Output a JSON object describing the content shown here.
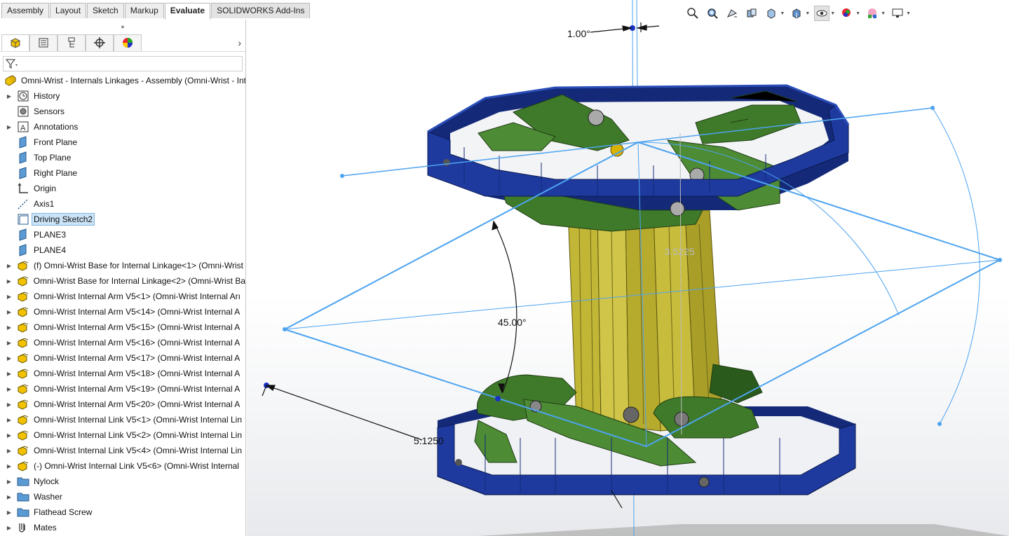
{
  "tabs": [
    {
      "label": "Assembly",
      "active": false
    },
    {
      "label": "Layout",
      "active": false
    },
    {
      "label": "Sketch",
      "active": false
    },
    {
      "label": "Markup",
      "active": false
    },
    {
      "label": "Evaluate",
      "active": true
    },
    {
      "label": "SOLIDWORKS Add-Ins",
      "active": false
    }
  ],
  "panel": {
    "tabs": [
      "feature-manager-icon",
      "property-manager-icon",
      "configuration-manager-icon",
      "dim-xpert-icon",
      "display-manager-icon"
    ],
    "more": "›",
    "filter_icon": "filter-icon",
    "root_label": "Omni-Wrist - Internals Linkages - Assembly (Omni-Wrist - Int",
    "tree": [
      {
        "label": "History",
        "icon": "history-icon",
        "expandable": true
      },
      {
        "label": "Sensors",
        "icon": "sensors-icon",
        "expandable": false
      },
      {
        "label": "Annotations",
        "icon": "annotations-icon",
        "expandable": true
      },
      {
        "label": "Front Plane",
        "icon": "plane-icon",
        "expandable": false
      },
      {
        "label": "Top Plane",
        "icon": "plane-icon",
        "expandable": false
      },
      {
        "label": "Right Plane",
        "icon": "plane-icon",
        "expandable": false
      },
      {
        "label": "Origin",
        "icon": "origin-icon",
        "expandable": false
      },
      {
        "label": "Axis1",
        "icon": "axis-icon",
        "expandable": false
      },
      {
        "label": "Driving Sketch2",
        "icon": "sketch-icon",
        "expandable": false,
        "selected": true
      },
      {
        "label": "PLANE3",
        "icon": "plane-icon",
        "expandable": false
      },
      {
        "label": "PLANE4",
        "icon": "plane-icon",
        "expandable": false
      },
      {
        "label": "(f) Omni-Wrist Base for Internal Linkage<1> (Omni-Wrist",
        "icon": "part-icon",
        "expandable": true
      },
      {
        "label": "Omni-Wrist Base for Internal Linkage<2> (Omni-Wrist Ba",
        "icon": "part-icon",
        "expandable": true
      },
      {
        "label": "Omni-Wrist Internal Arm V5<1> (Omni-Wrist Internal Arı",
        "icon": "part-icon",
        "expandable": true
      },
      {
        "label": "Omni-Wrist Internal Arm V5<14> (Omni-Wrist Internal A",
        "icon": "part-icon",
        "expandable": true
      },
      {
        "label": "Omni-Wrist Internal Arm V5<15> (Omni-Wrist Internal A",
        "icon": "part-icon",
        "expandable": true
      },
      {
        "label": "Omni-Wrist Internal Arm V5<16> (Omni-Wrist Internal A",
        "icon": "part-icon",
        "expandable": true
      },
      {
        "label": "Omni-Wrist Internal Arm V5<17> (Omni-Wrist Internal A",
        "icon": "part-icon",
        "expandable": true
      },
      {
        "label": "Omni-Wrist Internal Arm V5<18> (Omni-Wrist Internal A",
        "icon": "part-icon",
        "expandable": true
      },
      {
        "label": "Omni-Wrist Internal Arm V5<19> (Omni-Wrist Internal A",
        "icon": "part-icon",
        "expandable": true
      },
      {
        "label": "Omni-Wrist Internal Arm V5<20> (Omni-Wrist Internal A",
        "icon": "part-icon",
        "expandable": true
      },
      {
        "label": "Omni-Wrist Internal Link V5<1> (Omni-Wrist Internal Lin",
        "icon": "part-icon",
        "expandable": true
      },
      {
        "label": "Omni-Wrist Internal Link V5<2> (Omni-Wrist Internal Lin",
        "icon": "part-icon",
        "expandable": true
      },
      {
        "label": "Omni-Wrist Internal Link V5<4> (Omni-Wrist Internal Lin",
        "icon": "part-icon",
        "expandable": true
      },
      {
        "label": "(-) Omni-Wrist Internal Link V5<6> (Omni-Wrist Internal",
        "icon": "part-icon",
        "expandable": true
      },
      {
        "label": "Nylock",
        "icon": "folder-icon",
        "expandable": true
      },
      {
        "label": "Washer",
        "icon": "folder-icon",
        "expandable": true
      },
      {
        "label": "Flathead Screw",
        "icon": "folder-icon",
        "expandable": true
      },
      {
        "label": "Mates",
        "icon": "mates-icon",
        "expandable": true
      }
    ]
  },
  "heads_up": [
    "zoom-to-fit-icon",
    "zoom-area-icon",
    "previous-view-icon",
    "section-view-icon",
    "view-orientation-icon",
    "display-style-icon",
    "hide-show-icon",
    "edit-appearance-icon",
    "apply-scene-icon",
    "view-settings-icon"
  ],
  "dimensions": {
    "top_angle": "1.00°",
    "main_angle": "45.00°",
    "length": "5.1250",
    "height": "3.5225"
  },
  "colors": {
    "ring": "#1e3a9e",
    "ring_dark": "#142a78",
    "arm": "#3f7a2a",
    "arm_dark": "#2a5a1c",
    "column": "#c2b636",
    "column_dark": "#8f8420",
    "sketch": "#4da3f0",
    "selection": "#cce4f7",
    "tab_bg": "#eeeeee"
  }
}
